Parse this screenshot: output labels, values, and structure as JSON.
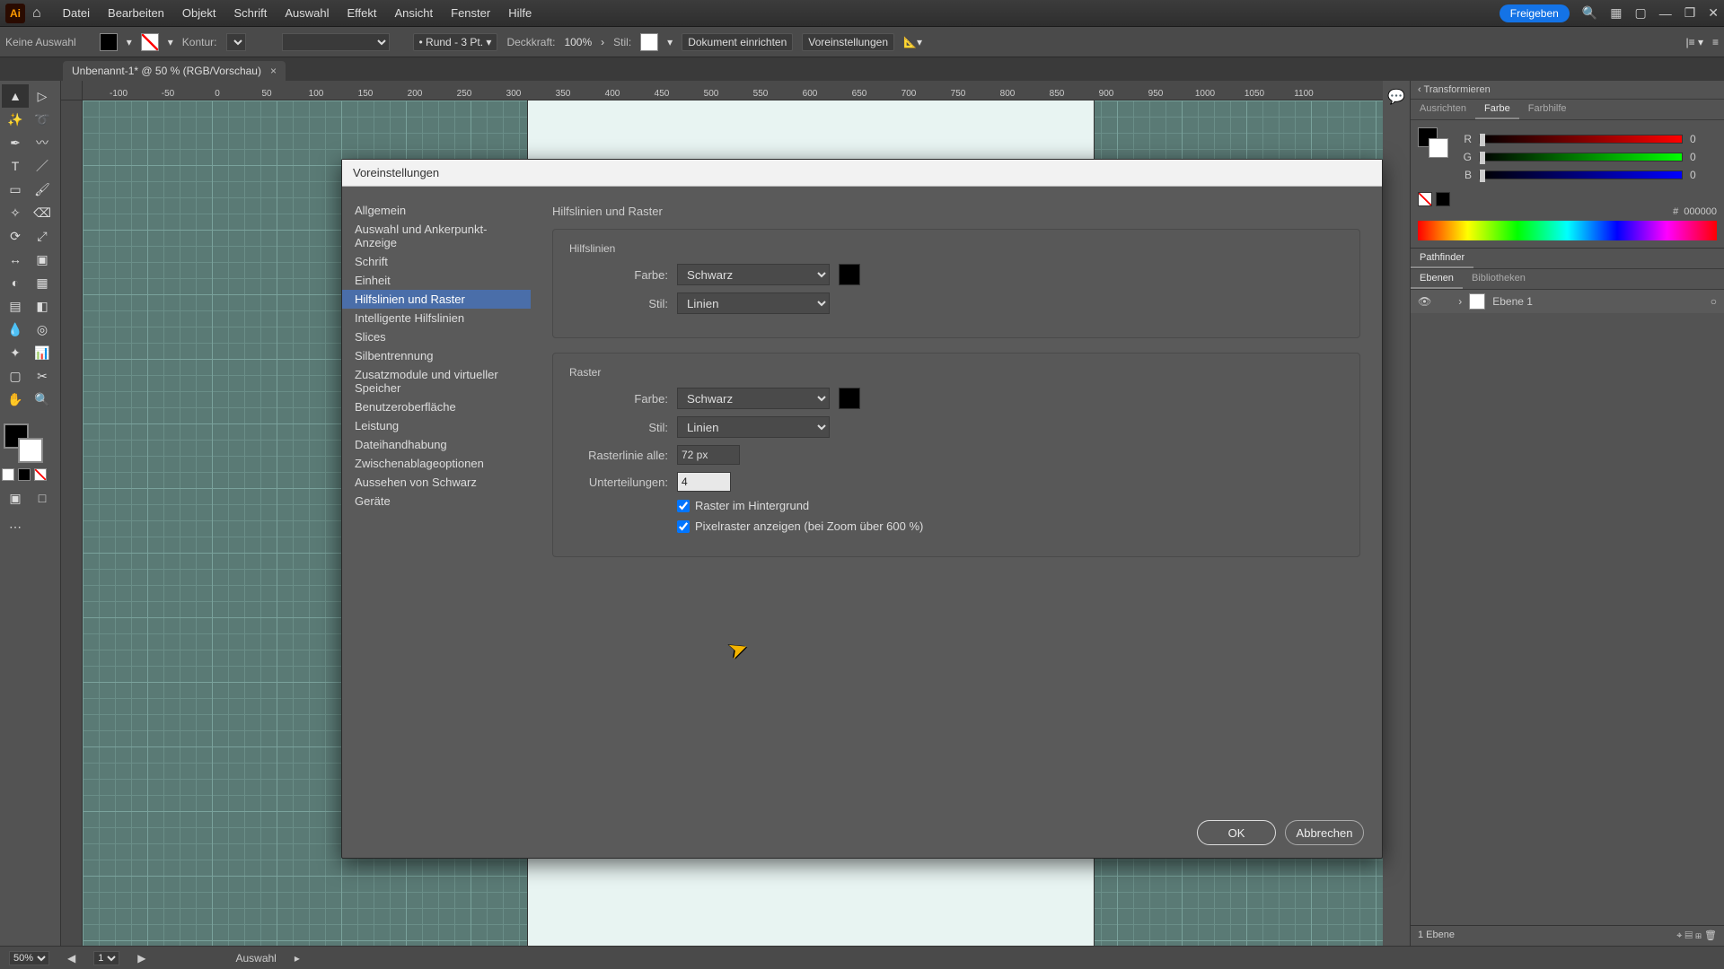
{
  "app": {
    "logo": "Ai"
  },
  "menubar": {
    "items": [
      "Datei",
      "Bearbeiten",
      "Objekt",
      "Schrift",
      "Auswahl",
      "Effekt",
      "Ansicht",
      "Fenster",
      "Hilfe"
    ],
    "share": "Freigeben"
  },
  "controlbar": {
    "no_selection": "Keine Auswahl",
    "stroke_lbl": "Kontur:",
    "stroke_style": "Rund - 3 Pt.",
    "opacity_lbl": "Deckkraft:",
    "opacity_val": "100%",
    "style_lbl": "Stil:",
    "btn_doc": "Dokument einrichten",
    "btn_prefs": "Voreinstellungen"
  },
  "tab": {
    "title": "Unbenannt-1* @ 50 % (RGB/Vorschau)"
  },
  "ruler": {
    "marks": [
      "-100",
      "-50",
      "0",
      "50",
      "100",
      "150",
      "200",
      "250",
      "300",
      "350",
      "400",
      "450",
      "500",
      "550",
      "600",
      "650",
      "700",
      "750",
      "800",
      "850",
      "900",
      "950",
      "1000",
      "1050",
      "1100"
    ]
  },
  "rightpanels": {
    "transform": "Transformieren",
    "tabs_top": [
      "Ausrichten",
      "Farbe",
      "Farbhilfe"
    ],
    "color": {
      "r": "R",
      "g": "G",
      "b": "B",
      "val": "0",
      "hex_lbl": "#",
      "hex": "000000"
    },
    "pathfinder": "Pathfinder",
    "tabs_layers": [
      "Ebenen",
      "Bibliotheken"
    ],
    "layer1": "Ebene 1",
    "layer_count": "1 Ebene"
  },
  "statusbar": {
    "zoom": "50%",
    "page": "1",
    "tool": "Auswahl"
  },
  "dialog": {
    "title": "Voreinstellungen",
    "categories": [
      "Allgemein",
      "Auswahl und Ankerpunkt-Anzeige",
      "Schrift",
      "Einheit",
      "Hilfslinien und Raster",
      "Intelligente Hilfslinien",
      "Slices",
      "Silbentrennung",
      "Zusatzmodule und virtueller Speicher",
      "Benutzeroberfläche",
      "Leistung",
      "Dateihandhabung",
      "Zwischenablageoptionen",
      "Aussehen von Schwarz",
      "Geräte"
    ],
    "selected_index": 4,
    "heading": "Hilfslinien und Raster",
    "guides": {
      "title": "Hilfslinien",
      "color_lbl": "Farbe:",
      "color_val": "Schwarz",
      "style_lbl": "Stil:",
      "style_val": "Linien"
    },
    "grid": {
      "title": "Raster",
      "color_lbl": "Farbe:",
      "color_val": "Schwarz",
      "style_lbl": "Stil:",
      "style_val": "Linien",
      "every_lbl": "Rasterlinie alle:",
      "every_val": "72 px",
      "subdiv_lbl": "Unterteilungen:",
      "subdiv_val": "4",
      "chk_back": "Raster im Hintergrund",
      "chk_pixel": "Pixelraster anzeigen (bei Zoom über 600 %)"
    },
    "ok": "OK",
    "cancel": "Abbrechen"
  }
}
